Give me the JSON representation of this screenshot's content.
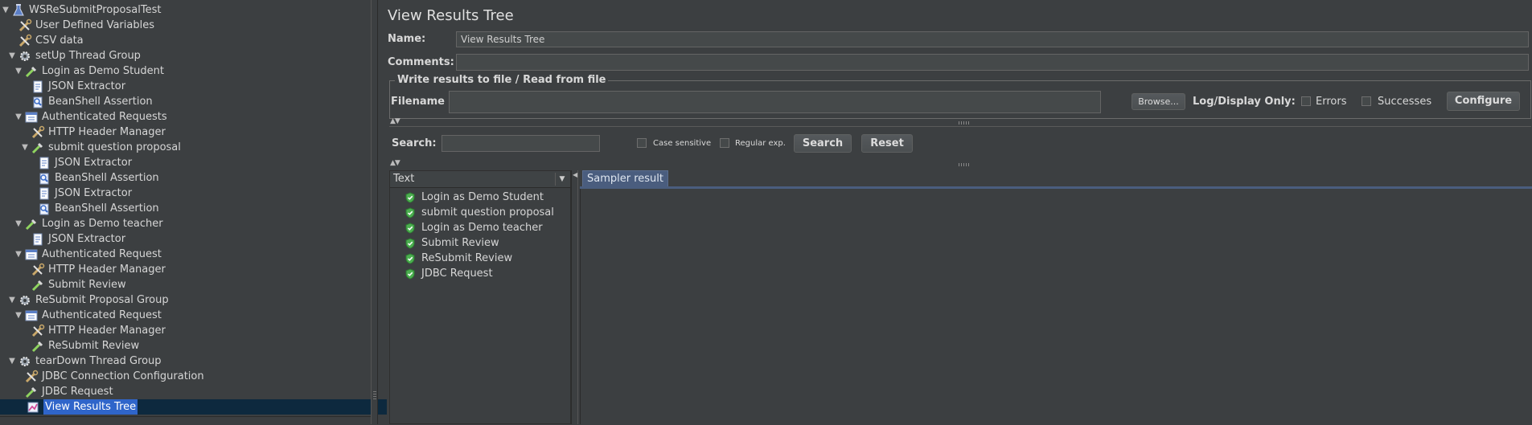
{
  "tree": {
    "items": [
      {
        "label": "WSReSubmitProposalTest",
        "icon": "test-plan-flask-icon",
        "toggle": "▼",
        "selected": false
      },
      {
        "label": "User Defined Variables",
        "icon": "config-wrench-icon",
        "toggle": "",
        "selected": false
      },
      {
        "label": "CSV data",
        "icon": "config-wrench-icon",
        "toggle": "",
        "selected": false
      },
      {
        "label": "setUp Thread Group",
        "icon": "thread-group-gear-icon",
        "toggle": "▼",
        "selected": false
      },
      {
        "label": "Login as Demo Student",
        "icon": "sampler-pipette-icon",
        "toggle": "▼",
        "selected": false
      },
      {
        "label": "JSON Extractor",
        "icon": "extractor-document-icon",
        "toggle": "",
        "selected": false
      },
      {
        "label": "BeanShell Assertion",
        "icon": "assertion-magnifier-icon",
        "toggle": "",
        "selected": false
      },
      {
        "label": "Authenticated Requests",
        "icon": "controller-list-icon",
        "toggle": "▼",
        "selected": false
      },
      {
        "label": "HTTP Header Manager",
        "icon": "config-wrench-icon",
        "toggle": "",
        "selected": false
      },
      {
        "label": "submit question proposal",
        "icon": "sampler-pipette-icon",
        "toggle": "▼",
        "selected": false
      },
      {
        "label": "JSON Extractor",
        "icon": "extractor-document-icon",
        "toggle": "",
        "selected": false
      },
      {
        "label": "BeanShell Assertion",
        "icon": "assertion-magnifier-icon",
        "toggle": "",
        "selected": false
      },
      {
        "label": "JSON Extractor",
        "icon": "extractor-document-icon",
        "toggle": "",
        "selected": false
      },
      {
        "label": "BeanShell Assertion",
        "icon": "assertion-magnifier-icon",
        "toggle": "",
        "selected": false
      },
      {
        "label": "Login as Demo teacher",
        "icon": "sampler-pipette-icon",
        "toggle": "▼",
        "selected": false
      },
      {
        "label": "JSON Extractor",
        "icon": "extractor-document-icon",
        "toggle": "",
        "selected": false
      },
      {
        "label": "Authenticated Request",
        "icon": "controller-list-icon",
        "toggle": "▼",
        "selected": false
      },
      {
        "label": "HTTP Header Manager",
        "icon": "config-wrench-icon",
        "toggle": "",
        "selected": false
      },
      {
        "label": "Submit Review",
        "icon": "sampler-pipette-icon",
        "toggle": "",
        "selected": false
      },
      {
        "label": "ReSubmit Proposal Group",
        "icon": "thread-group-gear-icon",
        "toggle": "▼",
        "selected": false
      },
      {
        "label": "Authenticated Request",
        "icon": "controller-list-icon",
        "toggle": "▼",
        "selected": false
      },
      {
        "label": "HTTP Header Manager",
        "icon": "config-wrench-icon",
        "toggle": "",
        "selected": false
      },
      {
        "label": "ReSubmit Review",
        "icon": "sampler-pipette-icon",
        "toggle": "",
        "selected": false
      },
      {
        "label": "tearDown Thread Group",
        "icon": "thread-group-gear-icon",
        "toggle": "▼",
        "selected": false
      },
      {
        "label": "JDBC Connection Configuration",
        "icon": "config-wrench-icon",
        "toggle": "",
        "selected": false
      },
      {
        "label": "JDBC Request",
        "icon": "sampler-pipette-icon",
        "toggle": "",
        "selected": false
      },
      {
        "label": "View Results Tree",
        "icon": "listener-chart-icon",
        "toggle": "",
        "selected": true
      }
    ]
  },
  "panel": {
    "title": "View Results Tree",
    "name_label": "Name:",
    "name_value": "View Results Tree",
    "comments_label": "Comments:",
    "comments_value": "",
    "file_group_title": "Write results to file / Read from file",
    "filename_label": "Filename",
    "filename_value": "",
    "browse_label": "Browse...",
    "log_display_label": "Log/Display Only:",
    "errors_label": "Errors",
    "successes_label": "Successes",
    "configure_label": "Configure",
    "search_label": "Search:",
    "search_value": "",
    "case_sensitive_label": "Case sensitive",
    "regular_exp_label": "Regular exp.",
    "search_button": "Search",
    "reset_button": "Reset"
  },
  "results": {
    "renderer": "Text",
    "items": [
      "Login as Demo Student",
      "submit question proposal",
      "Login as Demo teacher",
      "Submit Review",
      "ReSubmit Review",
      "JDBC Request"
    ],
    "status_icon": "success-shield-icon"
  },
  "sampler": {
    "tab_label": "Sampler result"
  },
  "colors": {
    "background": "#3c3f41",
    "selection": "#2f65ca",
    "selection_row": "#0d293e",
    "tab_active": "#4a5d7e",
    "success_green": "#4caf50"
  }
}
